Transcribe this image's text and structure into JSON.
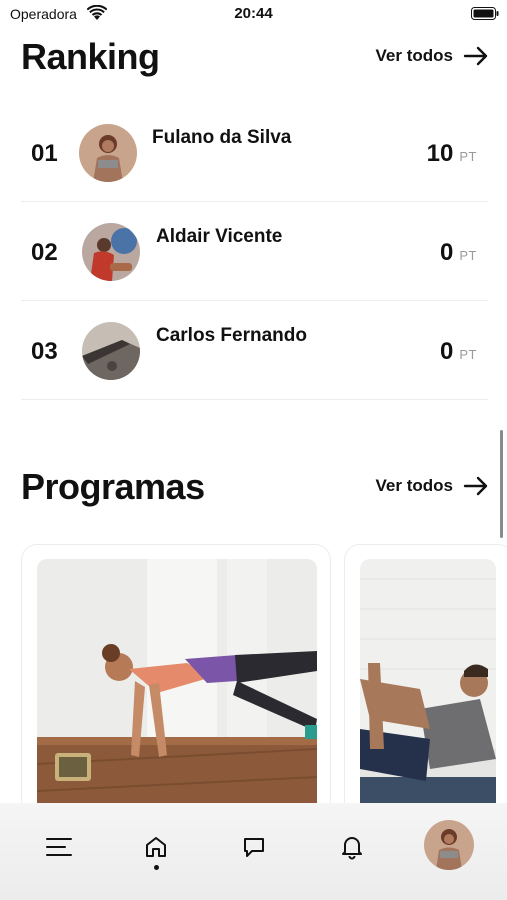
{
  "status_bar": {
    "carrier": "Operadora",
    "time": "20:44"
  },
  "ranking": {
    "title": "Ranking",
    "see_all": "Ver todos",
    "entries": [
      {
        "position": "01",
        "name": "Fulano da Silva",
        "score": "10",
        "unit": "PT"
      },
      {
        "position": "02",
        "name": "Aldair Vicente",
        "score": "0",
        "unit": "PT"
      },
      {
        "position": "03",
        "name": "Carlos Fernando",
        "score": "0",
        "unit": "PT"
      }
    ]
  },
  "programs": {
    "title": "Programas",
    "see_all": "Ver todos"
  },
  "tab_bar": {
    "tabs": [
      "menu-icon",
      "home-icon",
      "chat-icon",
      "bell-icon",
      "profile-avatar"
    ],
    "active": "home-icon"
  }
}
